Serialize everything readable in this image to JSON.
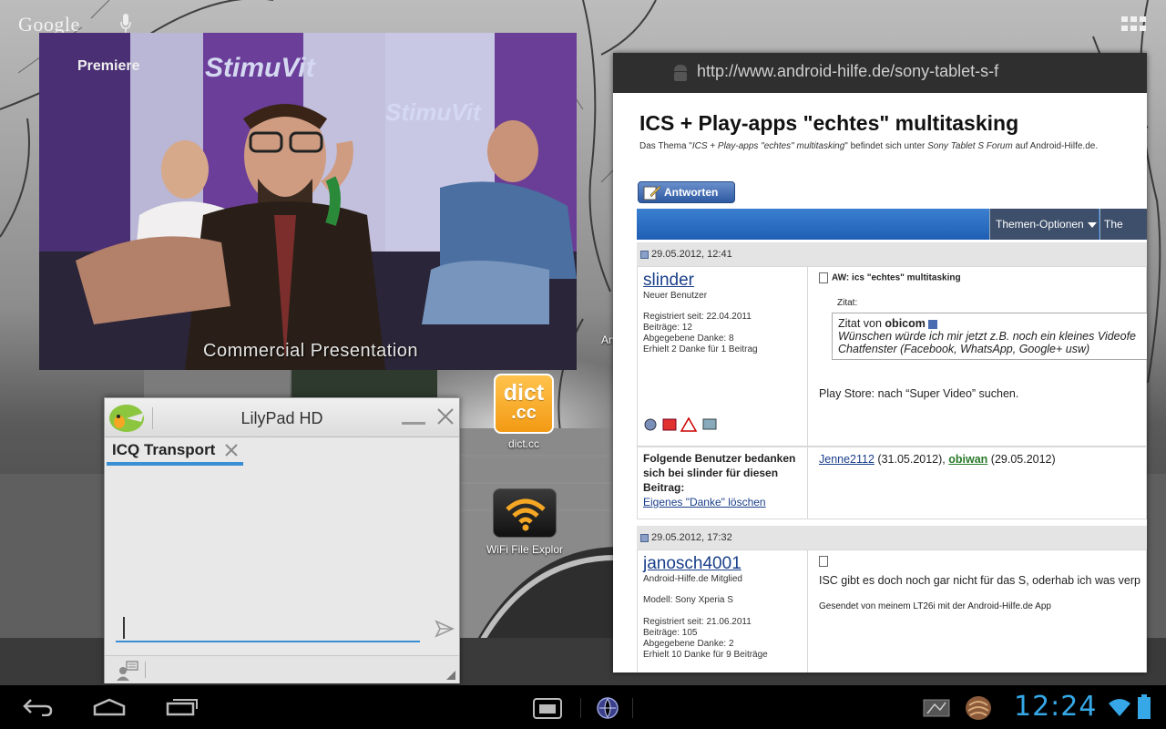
{
  "launcher": {
    "search_label": "Google",
    "desktop_icons": [
      {
        "label": "dict.cc",
        "tile_line1": "dict",
        "tile_line2": ".cc"
      },
      {
        "label": "WiFi File Explor"
      },
      {
        "partial_label": "An"
      }
    ]
  },
  "video_window": {
    "logo_text": "Premiere",
    "banner_text": "StimuVit",
    "caption": "Commercial Presentation"
  },
  "lilypad": {
    "title": "LilyPad HD",
    "tab_label": "ICQ Transport"
  },
  "browser": {
    "url": "http://www.android-hilfe.de/sony-tablet-s-f",
    "thread_title": "ICS + Play-apps \"echtes\" multitasking",
    "thread_subtitle_prefix": "Das Thema \"",
    "thread_subtitle_title": "ICS + Play-apps \"echtes\" multitasking",
    "thread_subtitle_mid": "\" befindet sich unter ",
    "thread_subtitle_forum": "Sony Tablet S Forum",
    "thread_subtitle_suffix": " auf Android-Hilfe.de.",
    "reply_label": "Antworten",
    "themen_options": "Themen-Optionen",
    "themen_more": "The",
    "posts": [
      {
        "date": "29.05.2012, 12:41",
        "username": "slinder",
        "user_title": "Neuer Benutzer",
        "info": [
          "Registriert seit: 22.04.2011",
          "Beiträge: 12",
          "Abgegebene Danke: 8",
          "Erhielt 2 Danke für 1 Beitrag"
        ],
        "subject": "AW: ics \"echtes\" multitasking",
        "quote_label": "Zitat:",
        "quote_from_prefix": "Zitat von ",
        "quote_author": "obicom",
        "quote_text": "Wünschen würde ich mir jetzt z.B. noch ein kleines Videofe Chatfenster (Facebook, WhatsApp, Google+ usw)",
        "body": "Play Store: nach “Super Video” suchen."
      },
      {
        "date": "29.05.2012, 17:32",
        "username": "janosch4001",
        "user_title": "Android-Hilfe.de Mitglied",
        "model": "Modell: Sony Xperia S",
        "info": [
          "Registriert seit: 21.06.2011",
          "Beiträge: 105",
          "Abgegebene Danke: 2",
          "Erhielt 10 Danke für 9 Beiträge"
        ],
        "body": "ISC gibt es doch noch gar nicht für das S, oderhab ich was verp",
        "signature": "Gesendet von meinem LT26i mit der Android-Hilfe.de App"
      }
    ],
    "thanks": {
      "label": "Folgende Benutzer bedanken sich bei slinder für diesen Beitrag:",
      "remove_link": "Eigenes \"Danke\" löschen",
      "user1": "Jenne2112",
      "date1": " (31.05.2012), ",
      "user2": "obiwan",
      "date2": " (29.05.2012)"
    }
  },
  "status_bar": {
    "clock": "12:24"
  },
  "colors": {
    "clock": "#36a8e8",
    "forum_blue": "#1f5fb3",
    "lilypad_accent": "#3a8ed4",
    "dictcc_orange": "#f39a14"
  }
}
